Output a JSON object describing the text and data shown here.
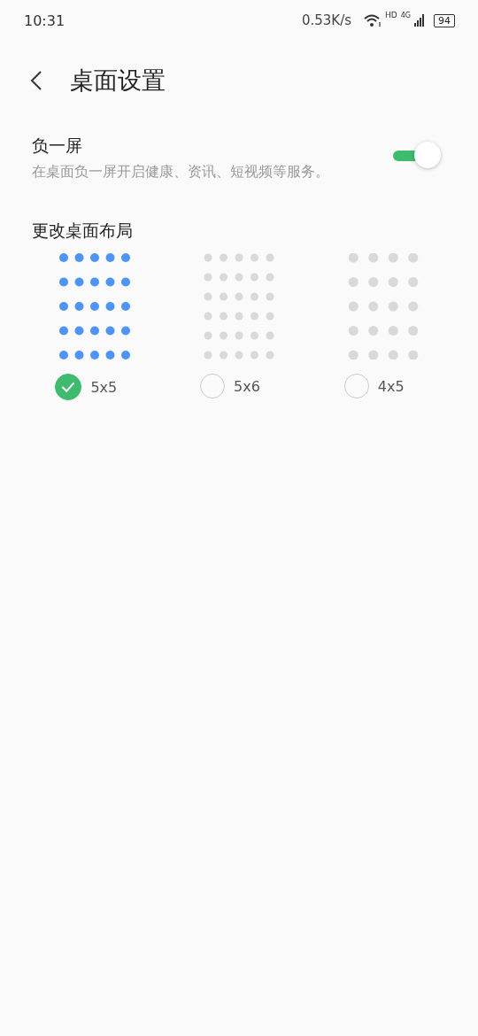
{
  "status_bar": {
    "time": "10:31",
    "speed": "0.53K/s",
    "hd": "HD",
    "network": "4G",
    "battery": "94"
  },
  "header": {
    "title": "桌面设置"
  },
  "minus_one_screen": {
    "title": "负一屏",
    "description": "在桌面负一屏开启健康、资讯、短视频等服务。",
    "on": true
  },
  "layout_section": {
    "title": "更改桌面布局",
    "options": [
      {
        "label": "5x5",
        "kind": "five-by-five",
        "selected": true
      },
      {
        "label": "5x6",
        "kind": "five-by-six",
        "selected": false
      },
      {
        "label": "4x5",
        "kind": "four-by-five",
        "selected": false
      }
    ]
  }
}
